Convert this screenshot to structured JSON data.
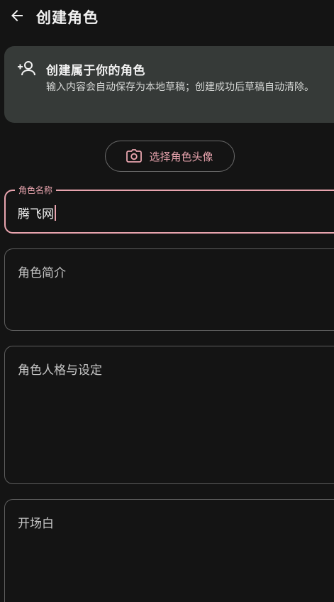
{
  "header": {
    "title": "创建角色",
    "back_icon": "arrow-left-icon"
  },
  "info_card": {
    "icon": "person-add-icon",
    "title": "创建属于你的角色",
    "description": "输入内容会自动保存为本地草稿；创建成功后草稿自动清除。"
  },
  "avatar_button": {
    "icon": "camera-icon",
    "label": "选择角色头像"
  },
  "fields": {
    "name": {
      "label": "角色名称",
      "value": "腾飞网",
      "state": "focused"
    },
    "intro": {
      "placeholder": "角色简介"
    },
    "persona": {
      "placeholder": "角色人格与设定"
    },
    "opening": {
      "placeholder": "开场白"
    }
  },
  "colors": {
    "background": "#141414",
    "card": "#363a38",
    "accent": "#e8a4ae",
    "border": "#5e5e5e"
  }
}
